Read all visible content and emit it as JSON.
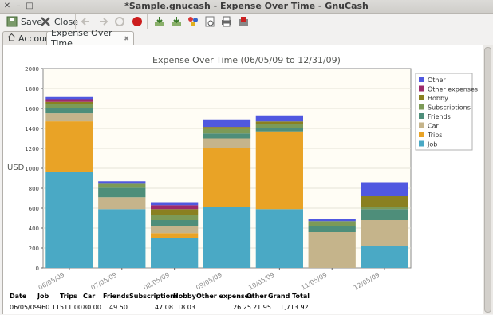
{
  "window": {
    "title": "*Sample.gnucash - Expense Over Time - GnuCash"
  },
  "toolbar": {
    "save_label": "Save",
    "close_label": "Close"
  },
  "tabs": [
    {
      "label": "Accounts"
    },
    {
      "label": "Expense Over Time",
      "close": "✖"
    }
  ],
  "chart_data": {
    "type": "bar",
    "stacked": true,
    "title": "Expense Over Time (06/05/09 to 12/31/09)",
    "ylabel": "USD",
    "xlabel": "",
    "ylim": [
      0,
      2000
    ],
    "yticks": [
      0,
      200,
      400,
      600,
      800,
      1000,
      1200,
      1400,
      1600,
      1800,
      2000
    ],
    "grid": true,
    "legend_placement": "top-right",
    "categories": [
      "06/05/09",
      "07/05/09",
      "08/05/09",
      "09/05/09",
      "10/05/09",
      "11/05/09",
      "12/05/09"
    ],
    "series": [
      {
        "name": "Job",
        "color": "#4aa9c5",
        "values": [
          960.11,
          590,
          300,
          610,
          590,
          0,
          220
        ]
      },
      {
        "name": "Trips",
        "color": "#e9a326",
        "values": [
          511.0,
          0,
          50,
          590,
          780,
          0,
          0
        ]
      },
      {
        "name": "Car",
        "color": "#c5b48b",
        "values": [
          80.0,
          120,
          70,
          100,
          0,
          360,
          260
        ]
      },
      {
        "name": "Friends",
        "color": "#4e8e7a",
        "values": [
          49.5,
          95,
          60,
          50,
          30,
          60,
          110
        ]
      },
      {
        "name": "Subscriptions",
        "color": "#7c9a57",
        "values": [
          47.08,
          40,
          50,
          45,
          40,
          50,
          20
        ]
      },
      {
        "name": "Hobby",
        "color": "#8a8020",
        "values": [
          18.03,
          0,
          60,
          20,
          30,
          0,
          110
        ]
      },
      {
        "name": "Other expenses",
        "color": "#9c2a6a",
        "values": [
          26.25,
          0,
          40,
          0,
          0,
          0,
          0
        ]
      },
      {
        "name": "Other",
        "color": "#5058e0",
        "values": [
          21.95,
          25,
          30,
          75,
          60,
          20,
          140
        ]
      }
    ]
  },
  "table": {
    "headers": [
      "Date",
      "Job",
      "Trips",
      "Car",
      "Friends",
      "Subscriptions",
      "Hobby",
      "Other expenses",
      "Other",
      "Grand Total"
    ],
    "rows": [
      [
        "06/05/09",
        "960.11",
        "511.00",
        "80.00",
        "49.50",
        "47.08",
        "18.03",
        "26.25",
        "21.95",
        "1,713.92"
      ]
    ]
  }
}
